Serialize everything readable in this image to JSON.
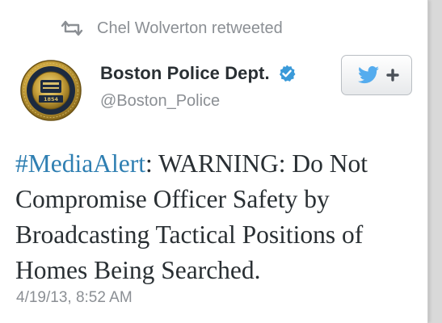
{
  "retweet": {
    "icon": "retweet-icon",
    "text": "Chel Wolverton retweeted"
  },
  "author": {
    "display_name": "Boston Police Dept.",
    "handle": "@Boston_Police",
    "verified": true,
    "avatar": "police-badge-avatar",
    "seal_year": "1854"
  },
  "follow_button": {
    "icon": "twitter-bird-plus-icon"
  },
  "tweet": {
    "hashtag": "#MediaAlert",
    "line1_rest": ": WARNING: Do Not",
    "line2": "Compromise Officer Safety by",
    "line3": "Broadcasting Tactical Positions of",
    "line4": "Homes Being Searched.",
    "timestamp": "4/19/13, 8:52 AM"
  },
  "colors": {
    "hashtag": "#2f7fb2",
    "verified": "#3a9ad9",
    "twitter_bird": "#55acee",
    "secondary_text": "#8b8f94",
    "primary_text": "#292f33"
  }
}
